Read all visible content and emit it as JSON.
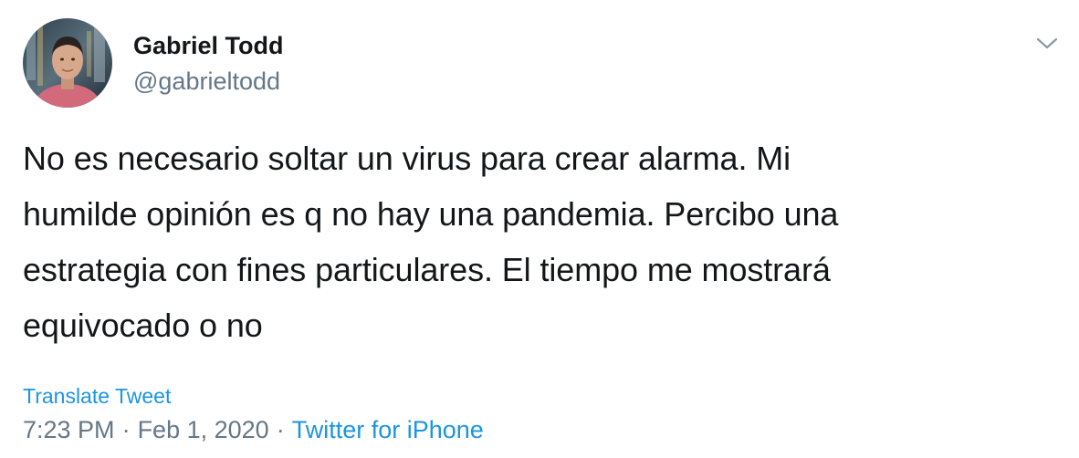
{
  "author": {
    "display_name": "Gabriel Todd",
    "handle": "@gabrieltodd",
    "avatar": "profile-photo"
  },
  "menu": {
    "icon": "chevron-down-icon"
  },
  "tweet": {
    "text": "No es necesario soltar un virus para crear alarma. Mi\nhumilde opinión es q no hay una pandemia. Percibo una\nestrategia con fines particulares. El tiempo me mostrará\nequivocado o no",
    "translate_label": "Translate Tweet",
    "time": "7:23 PM",
    "separator": "·",
    "date": "Feb 1, 2020",
    "source": "Twitter for iPhone"
  },
  "colors": {
    "text": "#14171a",
    "secondary": "#657786",
    "link": "#1b95e0",
    "background": "#ffffff"
  }
}
